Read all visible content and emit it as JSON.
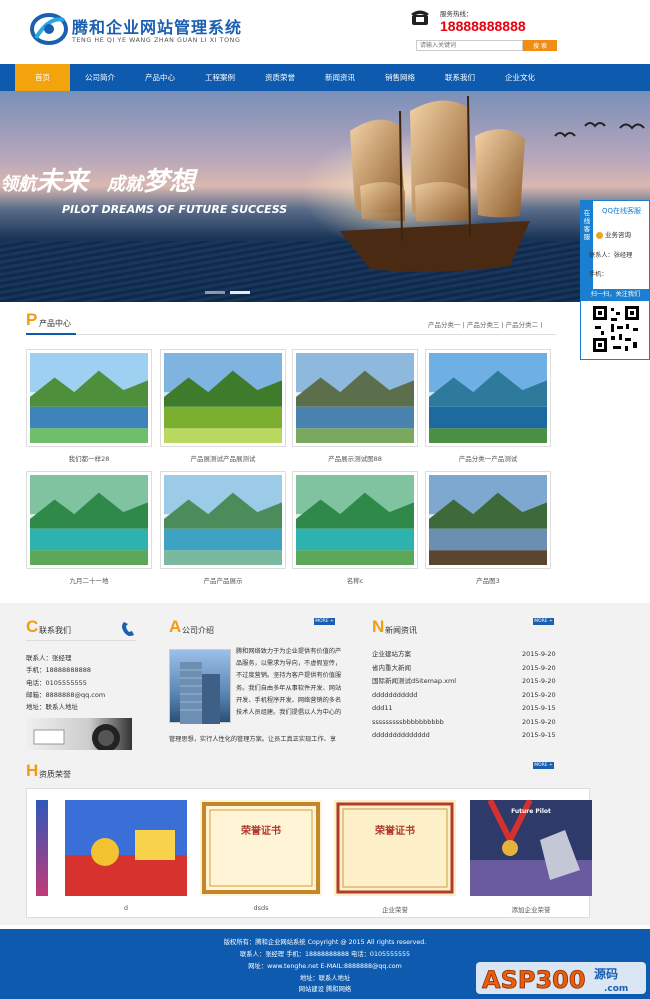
{
  "header": {
    "logo_title": "腾和企业网站管理系统",
    "logo_sub": "TENG HE QI YE WANG ZHAN GUAN LI XI TONG",
    "hotline_label": "服务热线：",
    "hotline_number": "18888888888",
    "search_placeholder": "请输入关键词",
    "search_button": "搜 索"
  },
  "nav": {
    "items": [
      "首页",
      "公司简介",
      "产品中心",
      "工程案例",
      "资质荣誉",
      "新闻资讯",
      "销售网络",
      "联系我们",
      "企业文化"
    ]
  },
  "banner": {
    "text_a": "领航",
    "text_b": "未来",
    "text_c": "成就",
    "text_d": "梦想",
    "text_en": "PILOT DREAMS OF FUTURE SUCCESS"
  },
  "side": {
    "tab": "在线客服",
    "title": "QQ在线客服",
    "chat": "业务咨询",
    "contact": "联系人：张经理",
    "phone": "手机：",
    "scan": "扫一扫，关注我们"
  },
  "products": {
    "letter": "P",
    "title": "产品中心",
    "categories": "产品分类一 | 产品分类三 | 产品分类二 |",
    "items": [
      {
        "name": "我们都一样28",
        "scene": "lake-trees"
      },
      {
        "name": "产品展测试产品展测试",
        "scene": "green-field"
      },
      {
        "name": "产品展示测试图88",
        "scene": "mountain-lake"
      },
      {
        "name": "产品分类一产品测试",
        "scene": "sea-island"
      },
      {
        "name": "九月二十一地",
        "scene": "tropical-lake"
      },
      {
        "name": "产品产品展示",
        "scene": "river-valley"
      },
      {
        "name": "名称c",
        "scene": "tropical-lake"
      },
      {
        "name": "产品图3",
        "scene": "pier"
      }
    ]
  },
  "contact": {
    "letter": "C",
    "title": "联系我们",
    "lines": [
      "联系人：张经理",
      "手机：18888888888",
      "电话：0105555555",
      "邮箱：8888888@qq.com",
      "地址：联系人地址"
    ]
  },
  "about": {
    "letter": "A",
    "title": "公司介绍",
    "more": "MORE +",
    "text": "腾和网络致力于为企业提供有价值的产品服务，以需求为导向，不虚假宣传，不过度营销。坚持为客户提供有价值服务。我们自由多年从事软件开发、网站开发、手机程序开发、网络营销的多名技术人员组建。我们提倡以人为中心的",
    "text2": "管理思想，实行人性化的管理方案。让员工真正实现工作、享"
  },
  "news": {
    "letter": "N",
    "title": "新闻资讯",
    "more": "MORE +",
    "items": [
      {
        "title": "企业建站方案",
        "date": "2015-9-20"
      },
      {
        "title": "省内重大新闻",
        "date": "2015-9-20"
      },
      {
        "title": "国际新闻测试dSitemap.xml",
        "date": "2015-9-20"
      },
      {
        "title": "ddddddddddd",
        "date": "2015-9-20"
      },
      {
        "title": "ddd11",
        "date": "2015-9-15"
      },
      {
        "title": "sssssssssbbbbbbbbbb",
        "date": "2015-9-20"
      },
      {
        "title": "dddddddddddddd",
        "date": "2015-9-15"
      }
    ]
  },
  "honor": {
    "letter": "H",
    "title": "资质荣誉",
    "more": "MORE +",
    "items": [
      {
        "name": "d",
        "cert_text": ""
      },
      {
        "name": "dsds",
        "cert_text": "荣誉证书"
      },
      {
        "name": "企业荣誉",
        "cert_text": "荣誉证书"
      },
      {
        "name": "添加企业荣誉",
        "cert_text": "Future Pilot"
      }
    ]
  },
  "footer": {
    "line1": "版权所有：腾和企业网站系统 Copyright @ 2015 All rights reserved.",
    "line2": "联系人：张经理 手机：18888888888 电话：0105555555",
    "line3": "网址：www.tenghe.net E-MAIL:8888888@qq.com",
    "line4": "地址：联系人地址",
    "line5": "网站建设 腾和网络"
  },
  "watermark": "ASP300 源码 .com",
  "colors": {
    "nav_blue": "#0d5aae",
    "accent_orange": "#f3a40d",
    "hotline_red": "#e60012"
  }
}
